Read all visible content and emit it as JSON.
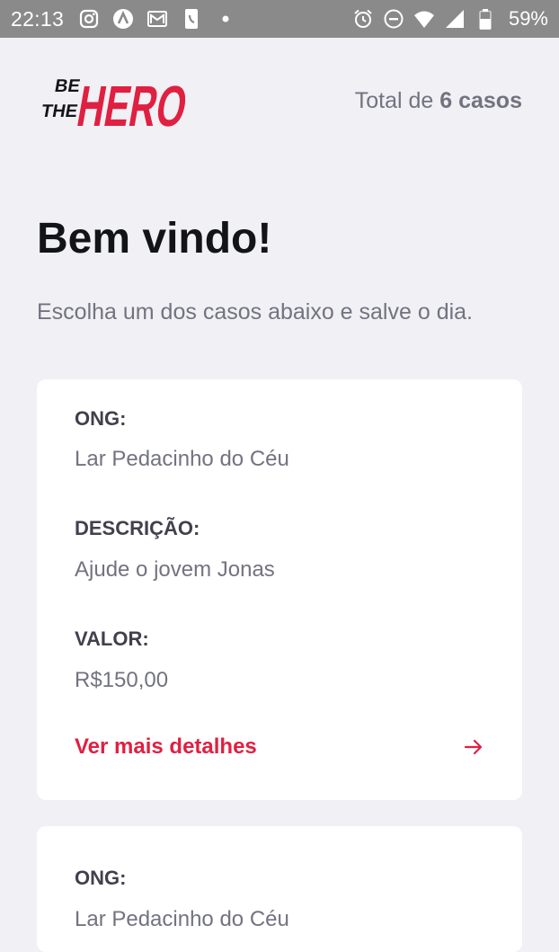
{
  "status_bar": {
    "time": "22:13",
    "battery_percent": "59%",
    "left_icons": [
      "instagram-icon",
      "a-circle-icon",
      "gallery-icon",
      "phone-icon",
      "dot-icon"
    ],
    "right_icons": [
      "alarm-icon",
      "dnd-icon",
      "wifi-icon",
      "signal-icon",
      "battery-icon"
    ]
  },
  "header": {
    "logo_text": [
      "BE",
      "THE",
      "HERO"
    ],
    "total_prefix": "Total de ",
    "total_count": "6 casos"
  },
  "title": "Bem vindo!",
  "description": "Escolha um dos casos abaixo e salve o dia.",
  "cases": [
    {
      "ong_label": "ONG:",
      "ong_value": "Lar Pedacinho do Céu",
      "desc_label": "DESCRIÇÃO:",
      "desc_value": "Ajude o jovem Jonas",
      "value_label": "VALOR:",
      "value_value": "R$150,00",
      "details_label": "Ver mais detalhes"
    },
    {
      "ong_label": "ONG:",
      "ong_value": "Lar Pedacinho do Céu"
    }
  ],
  "colors": {
    "brand_red": "#e02041",
    "background": "#f0f0f5",
    "status_bar": "#8a8a8a",
    "title": "#13131a",
    "muted_text": "#737380",
    "label_text": "#41414d"
  }
}
